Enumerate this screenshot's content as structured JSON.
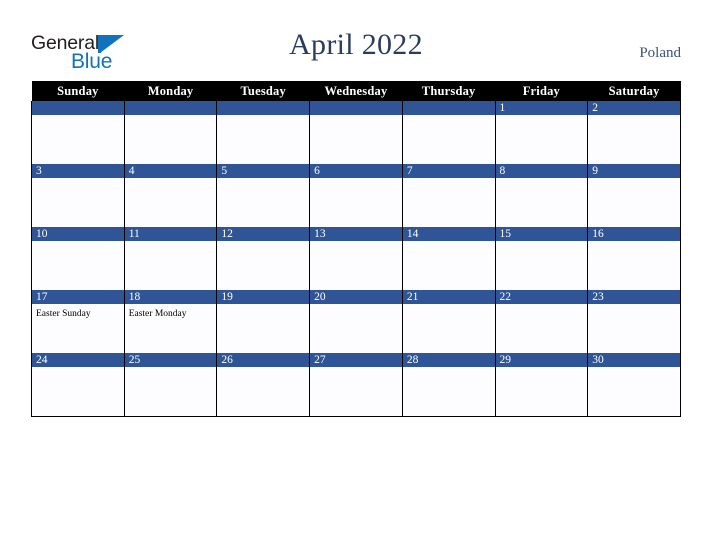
{
  "brand": {
    "name_part1": "General",
    "name_part2": "Blue",
    "triangle_icon": "blue-triangle-icon",
    "color_dark": "#231f20",
    "color_blue": "#1273bd"
  },
  "header": {
    "title": "April 2022",
    "region": "Poland",
    "title_color": "#2b3c5e",
    "region_color": "#3c5080"
  },
  "calendar": {
    "accent_color": "#2f5596",
    "header_bg": "#000000",
    "cell_bg": "#fdfdff",
    "weekday_headers": [
      "Sunday",
      "Monday",
      "Tuesday",
      "Wednesday",
      "Thursday",
      "Friday",
      "Saturday"
    ],
    "weeks": [
      [
        {
          "day": "",
          "events": []
        },
        {
          "day": "",
          "events": []
        },
        {
          "day": "",
          "events": []
        },
        {
          "day": "",
          "events": []
        },
        {
          "day": "",
          "events": []
        },
        {
          "day": "1",
          "events": []
        },
        {
          "day": "2",
          "events": []
        }
      ],
      [
        {
          "day": "3",
          "events": []
        },
        {
          "day": "4",
          "events": []
        },
        {
          "day": "5",
          "events": []
        },
        {
          "day": "6",
          "events": []
        },
        {
          "day": "7",
          "events": []
        },
        {
          "day": "8",
          "events": []
        },
        {
          "day": "9",
          "events": []
        }
      ],
      [
        {
          "day": "10",
          "events": []
        },
        {
          "day": "11",
          "events": []
        },
        {
          "day": "12",
          "events": []
        },
        {
          "day": "13",
          "events": []
        },
        {
          "day": "14",
          "events": []
        },
        {
          "day": "15",
          "events": []
        },
        {
          "day": "16",
          "events": []
        }
      ],
      [
        {
          "day": "17",
          "events": [
            "Easter Sunday"
          ]
        },
        {
          "day": "18",
          "events": [
            "Easter Monday"
          ]
        },
        {
          "day": "19",
          "events": []
        },
        {
          "day": "20",
          "events": []
        },
        {
          "day": "21",
          "events": []
        },
        {
          "day": "22",
          "events": []
        },
        {
          "day": "23",
          "events": []
        }
      ],
      [
        {
          "day": "24",
          "events": []
        },
        {
          "day": "25",
          "events": []
        },
        {
          "day": "26",
          "events": []
        },
        {
          "day": "27",
          "events": []
        },
        {
          "day": "28",
          "events": []
        },
        {
          "day": "29",
          "events": []
        },
        {
          "day": "30",
          "events": []
        }
      ]
    ]
  }
}
